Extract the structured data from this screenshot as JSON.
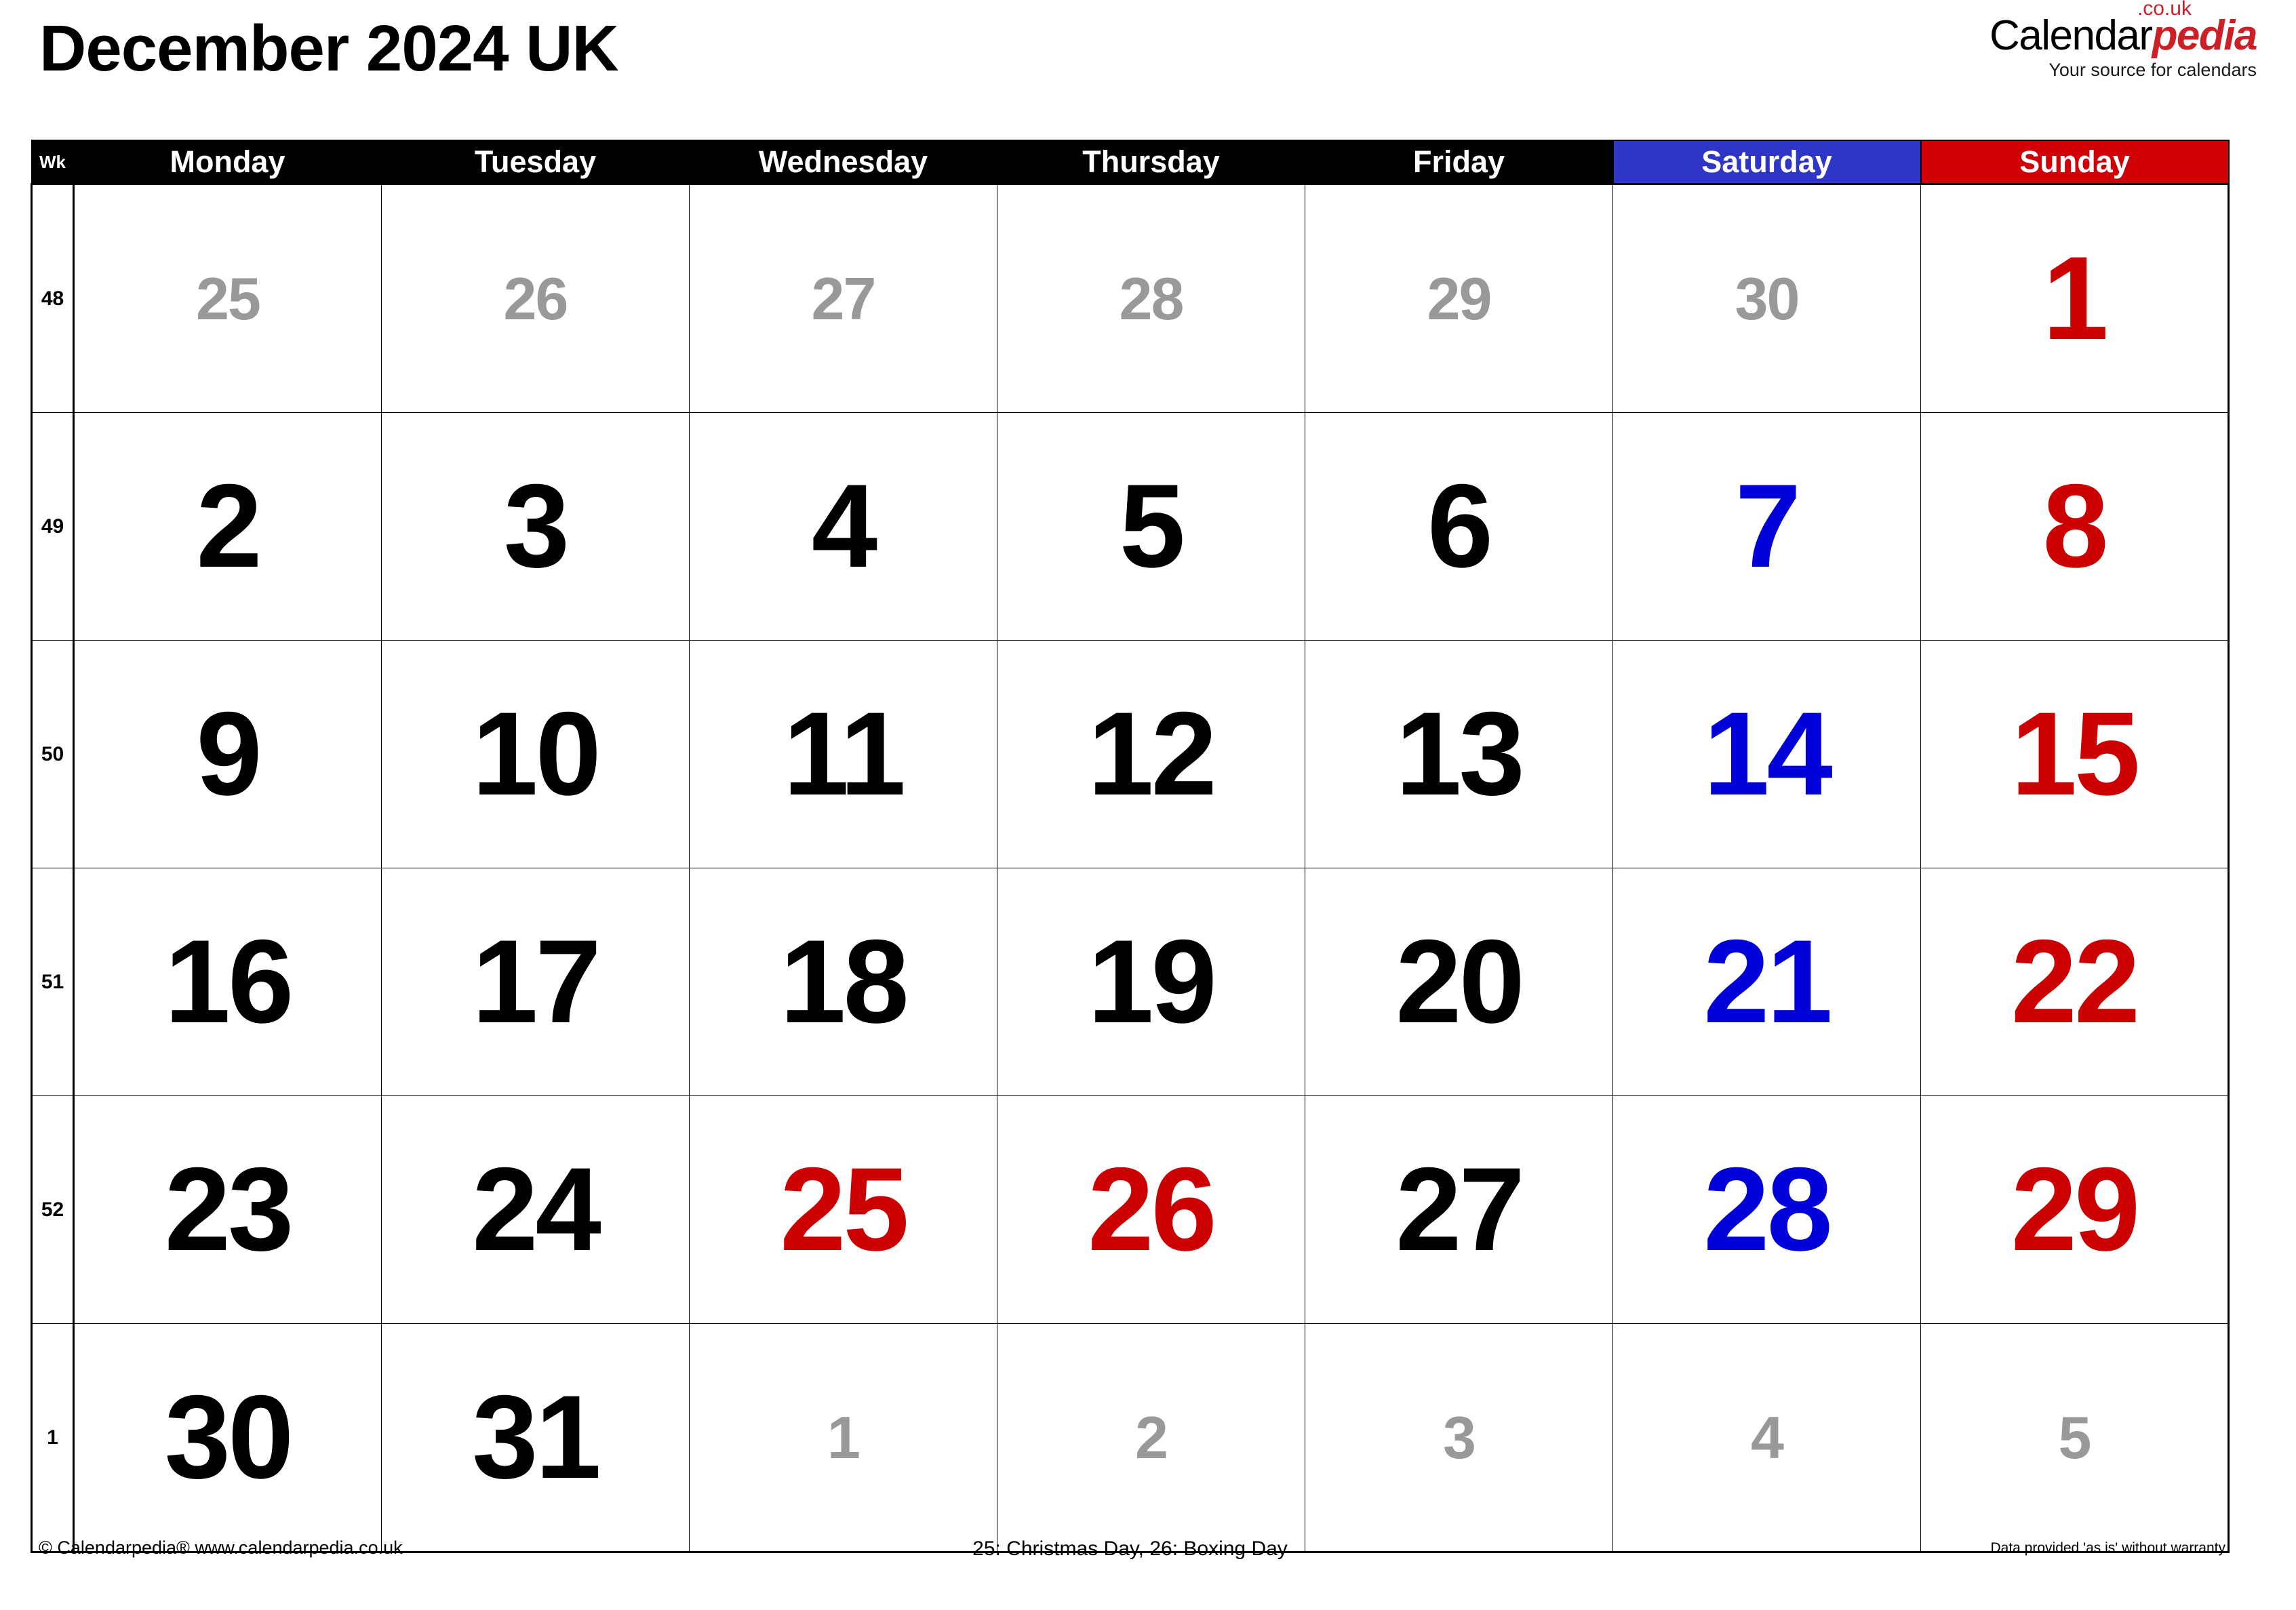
{
  "header": {
    "title": "December 2024 UK",
    "brand": {
      "name_part1": "Calendar",
      "name_part2": "pedia",
      "tld": ".co.uk",
      "tagline": "Your source for calendars"
    }
  },
  "colors": {
    "header_bg": "#000000",
    "saturday_header_bg": "#2f35c6",
    "sunday_header_bg": "#d10007",
    "saturday_text": "#0000d8",
    "sunday_text": "#cc0000",
    "holiday_text": "#cc0000",
    "other_month_text": "#999999",
    "weekday_text": "#000000"
  },
  "table": {
    "week_header": "Wk",
    "day_headers": [
      "Monday",
      "Tuesday",
      "Wednesday",
      "Thursday",
      "Friday",
      "Saturday",
      "Sunday"
    ],
    "rows": [
      {
        "week": "48",
        "days": [
          {
            "n": "25",
            "style": "other"
          },
          {
            "n": "26",
            "style": "other"
          },
          {
            "n": "27",
            "style": "other"
          },
          {
            "n": "28",
            "style": "other"
          },
          {
            "n": "29",
            "style": "other"
          },
          {
            "n": "30",
            "style": "other"
          },
          {
            "n": "1",
            "style": "cur-red"
          }
        ]
      },
      {
        "week": "49",
        "days": [
          {
            "n": "2",
            "style": "cur-black"
          },
          {
            "n": "3",
            "style": "cur-black"
          },
          {
            "n": "4",
            "style": "cur-black"
          },
          {
            "n": "5",
            "style": "cur-black"
          },
          {
            "n": "6",
            "style": "cur-black"
          },
          {
            "n": "7",
            "style": "cur-blue"
          },
          {
            "n": "8",
            "style": "cur-red"
          }
        ]
      },
      {
        "week": "50",
        "days": [
          {
            "n": "9",
            "style": "cur-black"
          },
          {
            "n": "10",
            "style": "cur-black"
          },
          {
            "n": "11",
            "style": "cur-black"
          },
          {
            "n": "12",
            "style": "cur-black"
          },
          {
            "n": "13",
            "style": "cur-black"
          },
          {
            "n": "14",
            "style": "cur-blue"
          },
          {
            "n": "15",
            "style": "cur-red"
          }
        ]
      },
      {
        "week": "51",
        "days": [
          {
            "n": "16",
            "style": "cur-black"
          },
          {
            "n": "17",
            "style": "cur-black"
          },
          {
            "n": "18",
            "style": "cur-black"
          },
          {
            "n": "19",
            "style": "cur-black"
          },
          {
            "n": "20",
            "style": "cur-black"
          },
          {
            "n": "21",
            "style": "cur-blue"
          },
          {
            "n": "22",
            "style": "cur-red"
          }
        ]
      },
      {
        "week": "52",
        "days": [
          {
            "n": "23",
            "style": "cur-black"
          },
          {
            "n": "24",
            "style": "cur-black"
          },
          {
            "n": "25",
            "style": "cur-red"
          },
          {
            "n": "26",
            "style": "cur-red"
          },
          {
            "n": "27",
            "style": "cur-black"
          },
          {
            "n": "28",
            "style": "cur-blue"
          },
          {
            "n": "29",
            "style": "cur-red"
          }
        ]
      },
      {
        "week": "1",
        "days": [
          {
            "n": "30",
            "style": "cur-black"
          },
          {
            "n": "31",
            "style": "cur-black"
          },
          {
            "n": "1",
            "style": "other"
          },
          {
            "n": "2",
            "style": "other"
          },
          {
            "n": "3",
            "style": "other"
          },
          {
            "n": "4",
            "style": "other"
          },
          {
            "n": "5",
            "style": "other"
          }
        ]
      }
    ]
  },
  "footer": {
    "copyright": "© Calendarpedia®   www.calendarpedia.co.uk",
    "holidays": "25: Christmas Day, 26: Boxing Day",
    "disclaimer": "Data provided 'as is' without warranty"
  }
}
